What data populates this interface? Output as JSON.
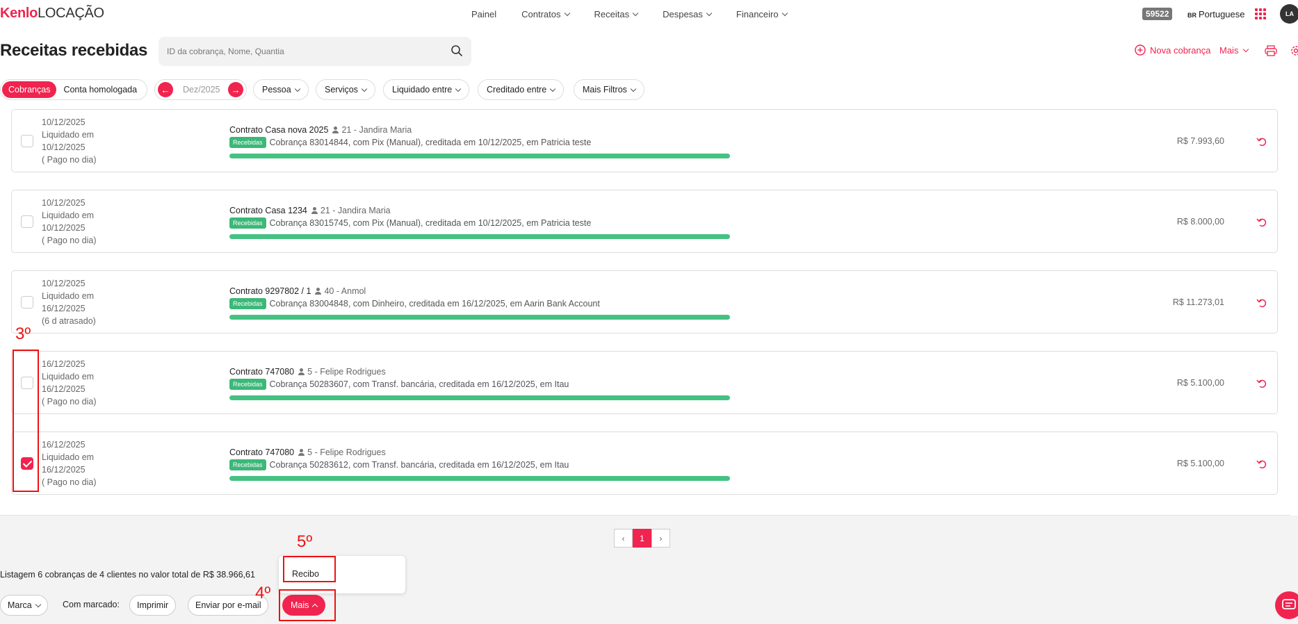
{
  "nav": {
    "logo_brand": "Kenlo",
    "logo_suffix": "LOCAÇÃO",
    "items": [
      {
        "label": "Painel",
        "dropdown": false
      },
      {
        "label": "Contratos",
        "dropdown": true
      },
      {
        "label": "Receitas",
        "dropdown": true
      },
      {
        "label": "Despesas",
        "dropdown": true
      },
      {
        "label": "Financeiro",
        "dropdown": true
      }
    ],
    "badge": "59522",
    "lang_code": "BR",
    "lang_label": "Portuguese",
    "avatar": "LA"
  },
  "header": {
    "title": "Receitas recebidas",
    "search_placeholder": "ID da cobrança, Nome, Quantia",
    "new_label": "Nova cobrança",
    "more_label": "Mais"
  },
  "filters": {
    "tab_active": "Cobranças",
    "tab_other": "Conta homologada",
    "month": "Dez/2025",
    "pills": [
      "Pessoa",
      "Serviços",
      "Liquidado entre",
      "Creditado entre",
      "Mais Filtros"
    ]
  },
  "rows": [
    {
      "date": "10/12/2025",
      "liq_label": "Liquidado em",
      "liq_date": "10/12/2025",
      "status": "( Pago no dia)",
      "contract": "Contrato Casa nova 2025",
      "person": "21 - Jandira Maria",
      "tag": "Recebidas",
      "desc": "Cobrança 83014844, com Pix (Manual), creditada em 10/12/2025, em Patricia teste",
      "amount": "R$ 7.993,60",
      "checked": false
    },
    {
      "date": "10/12/2025",
      "liq_label": "Liquidado em",
      "liq_date": "10/12/2025",
      "status": "( Pago no dia)",
      "contract": "Contrato Casa 1234",
      "person": "21 - Jandira Maria",
      "tag": "Recebidas",
      "desc": "Cobrança 83015745, com Pix (Manual), creditada em 10/12/2025, em Patricia teste",
      "amount": "R$ 8.000,00",
      "checked": false
    },
    {
      "date": "10/12/2025",
      "liq_label": "Liquidado em",
      "liq_date": "16/12/2025",
      "status": "(6 d atrasado)",
      "contract": "Contrato 9297802 / 1",
      "person": "40 - Anmol",
      "tag": "Recebidas",
      "desc": "Cobrança 83004848, com Dinheiro, creditada em 16/12/2025, em Aarin Bank Account",
      "amount": "R$ 11.273,01",
      "checked": false
    },
    {
      "date": "16/12/2025",
      "liq_label": "Liquidado em",
      "liq_date": "16/12/2025",
      "status": "( Pago no dia)",
      "contract": "Contrato 747080",
      "person": "5 - Felipe Rodrigues",
      "tag": "Recebidas",
      "desc": "Cobrança 50283607, com Transf. bancária, creditada em 16/12/2025, em Itau",
      "amount": "R$ 5.100,00",
      "checked": false
    },
    {
      "date": "16/12/2025",
      "liq_label": "Liquidado em",
      "liq_date": "16/12/2025",
      "status": "( Pago no dia)",
      "contract": "Contrato 747080",
      "person": "5 - Felipe Rodrigues",
      "tag": "Recebidas",
      "desc": "Cobrança 50283612, com Transf. bancária, creditada em 16/12/2025, em Itau",
      "amount": "R$ 5.100,00",
      "checked": true
    }
  ],
  "pagination": {
    "current": "1"
  },
  "footer": {
    "summary": "Listagem 6 cobranças de 4 clientes no valor total de R$ 38.966,61",
    "marca": "Marca",
    "com_marcado": "Com marcado:",
    "imprimir": "Imprimir",
    "email": "Enviar por e-mail",
    "mais": "Mais",
    "dropdown_option": "Recibo"
  },
  "annotations": [
    "3º",
    "4º",
    "5º"
  ],
  "colors": {
    "accent": "#f0244e",
    "success": "#45c282",
    "annotation": "#e11111"
  }
}
